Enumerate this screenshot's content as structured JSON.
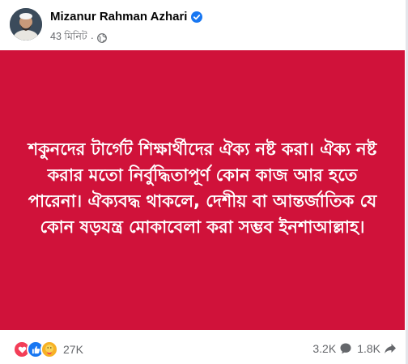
{
  "post": {
    "author": "Mizanur Rahman Azhari",
    "time": "43 মিনিট",
    "separator": "·",
    "body_text": "শকুনদের টার্গেট শিক্ষার্থীদের ঐক্য নষ্ট করা। ঐক্য নষ্ট করার মতো নির্বুদ্ধিতাপূর্ণ কোন কাজ আর হতে পারেনা। ঐক্যবদ্ধ থাকলে, দেশীয় বা আন্তর্জাতিক যে কোন ষড়যন্ত্র মোকাবেলা করা সম্ভব ইনশাআল্লাহ।",
    "background_color": "#d0123a"
  },
  "footer": {
    "reactions": [
      "love-icon",
      "like-icon",
      "care-icon"
    ],
    "reaction_count": "27K",
    "comments": "3.2K",
    "shares": "1.8K"
  }
}
